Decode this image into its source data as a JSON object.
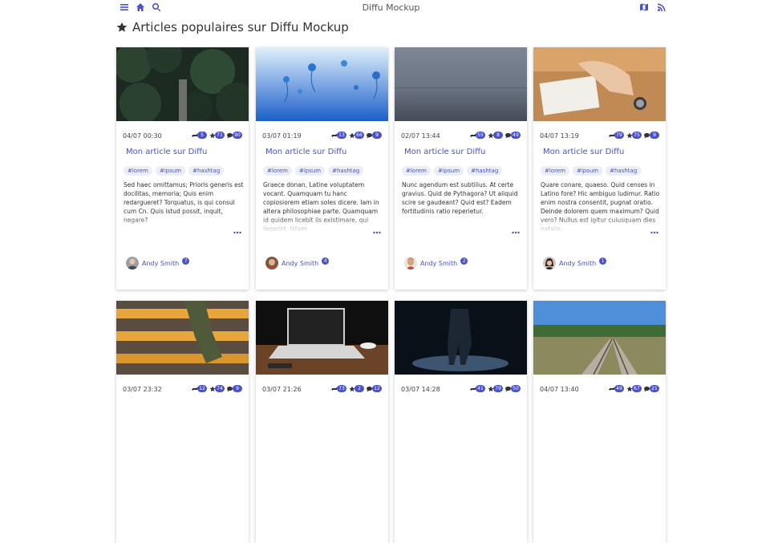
{
  "header": {
    "title": "Diffu Mockup"
  },
  "page": {
    "title": "Articles populaires sur Diffu Mockup"
  },
  "cards": [
    {
      "date": "04/07 00:30",
      "reposts": "5",
      "stars": "71",
      "comments": "90",
      "title": "Mon article sur Diffu",
      "tags": [
        "#lorem",
        "#ipsum",
        "#hashtag"
      ],
      "excerpt": "Sed haec omittamus; Prioris generis est docilitas, memoria; Quis enim redargueret? Torquatus, is qui consul cum Cn. Quis istud possit, inquit, negare?",
      "author": "Andy Smith",
      "author_count": "7"
    },
    {
      "date": "03/07 01:19",
      "reposts": "13",
      "stars": "66",
      "comments": "9",
      "title": "Mon article sur Diffu",
      "tags": [
        "#lorem",
        "#ipsum",
        "#hashtag"
      ],
      "excerpt": "Graece donan, Latine voluptatem vocant. Quamquam tu hanc copiosiorem etiam soles dicere. Iam in altera philosophiae parte. Quamquam id quidem licebit iis existimare, qui legerint. Istam",
      "author": "Andy Smith",
      "author_count": "4"
    },
    {
      "date": "02/07 13:44",
      "reposts": "55",
      "stars": "8",
      "comments": "49",
      "title": "Mon article sur Diffu",
      "tags": [
        "#lorem",
        "#ipsum",
        "#hashtag"
      ],
      "excerpt": "Nunc agendum est subtilius. At certe gravius. Quid de Pythagora? Ut aliquid scire se gaudeant? Quid est? Eadem fortitudinis ratio reperietur.",
      "author": "Andy Smith",
      "author_count": "2"
    },
    {
      "date": "04/07 13:19",
      "reposts": "79",
      "stars": "75",
      "comments": "9",
      "title": "Mon article sur Diffu",
      "tags": [
        "#lorem",
        "#ipsum",
        "#hashtag"
      ],
      "excerpt": "Quare conare, quaeso. Quid censes in Latino fore? Hic ambiguo ludimur. Ratio enim nostra consentit, pugnat oratio. Deinde dolorem quem maximum? Quid vero? Nullus est igitur cuiusquam dies natalis.",
      "author": "Andy Smith",
      "author_count": "1"
    },
    {
      "date": "03/07 23:32",
      "reposts": "12",
      "stars": "74",
      "comments": "9"
    },
    {
      "date": "03/07 21:26",
      "reposts": "73",
      "stars": "2",
      "comments": "12"
    },
    {
      "date": "03/07 14:28",
      "reposts": "41",
      "stars": "79",
      "comments": "50"
    },
    {
      "date": "04/07 13:40",
      "reposts": "49",
      "stars": "67",
      "comments": "21"
    }
  ]
}
